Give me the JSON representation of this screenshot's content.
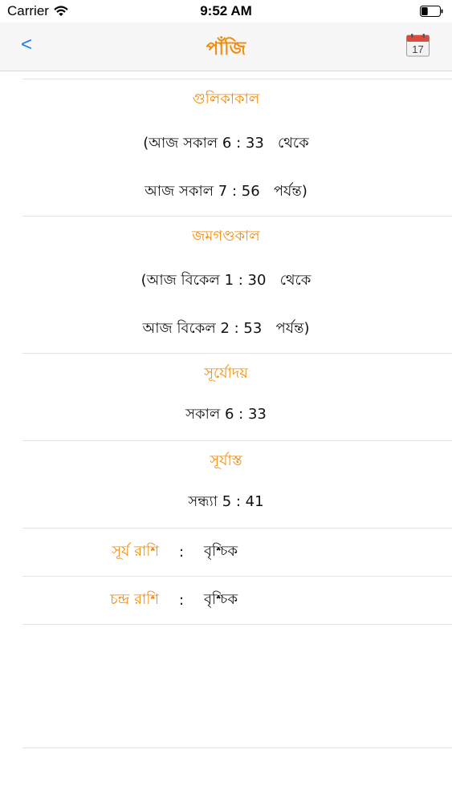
{
  "status": {
    "carrier": "Carrier",
    "time": "9:52 AM",
    "battery_level": 0.35
  },
  "nav": {
    "back_label": "<",
    "title": "পাঁজি",
    "calendar_day": "17"
  },
  "sections": [
    {
      "title": "গুলিকাকাল",
      "lines": [
        "(আজ সকাল 6 : 33   থেকে",
        "আজ সকাল 7 : 56   পর্যন্ত)"
      ]
    },
    {
      "title": "জমগণ্ডকাল",
      "lines": [
        "(আজ বিকেল 1 : 30   থেকে",
        "আজ বিকেল 2 : 53   পর্যন্ত)"
      ]
    },
    {
      "title": "সূর্যোদয়",
      "lines": [
        "সকাল 6 : 33"
      ]
    },
    {
      "title": "সূর্যাস্ত",
      "lines": [
        "সন্ধ্যা 5 : 41"
      ]
    }
  ],
  "rashi": [
    {
      "label": "সূর্য রাশি",
      "colon": ":",
      "value": "বৃশ্চিক"
    },
    {
      "label": "চন্দ্র রাশি",
      "colon": ":",
      "value": "বৃশ্চিক"
    }
  ],
  "colors": {
    "accent": "#f28b0c",
    "link": "#1a7cf5"
  }
}
